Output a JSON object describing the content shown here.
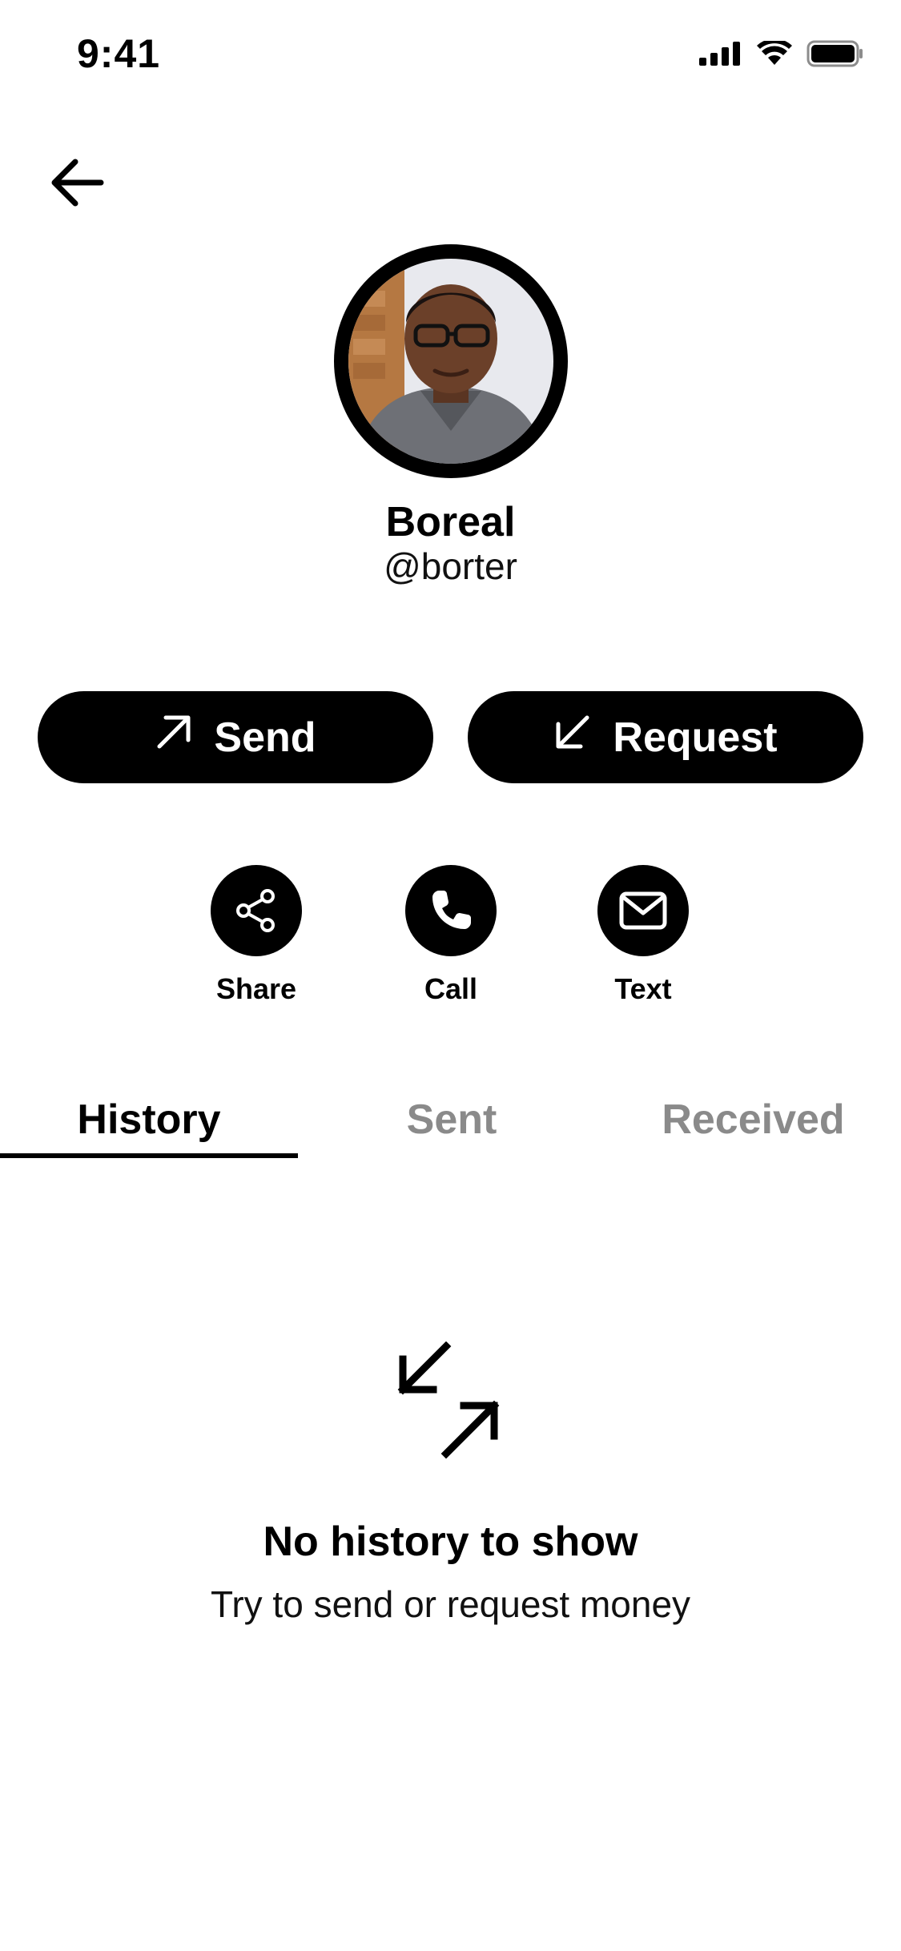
{
  "status_bar": {
    "time": "9:41"
  },
  "profile": {
    "name": "Boreal",
    "handle": "@borter"
  },
  "primary_actions": {
    "send_label": "Send",
    "request_label": "Request"
  },
  "quick_actions": [
    {
      "label": "Share",
      "icon": "share-icon"
    },
    {
      "label": "Call",
      "icon": "phone-icon"
    },
    {
      "label": "Text",
      "icon": "mail-icon"
    }
  ],
  "tabs": [
    {
      "label": "History",
      "active": true
    },
    {
      "label": "Sent",
      "active": false
    },
    {
      "label": "Received",
      "active": false
    }
  ],
  "empty_state": {
    "icon": "transfer-arrows-icon",
    "title": "No history to show",
    "subtitle": "Try to send or request money"
  },
  "colors": {
    "primary": "#000000",
    "background": "#ffffff",
    "inactive_tab": "#8a8a8a"
  }
}
